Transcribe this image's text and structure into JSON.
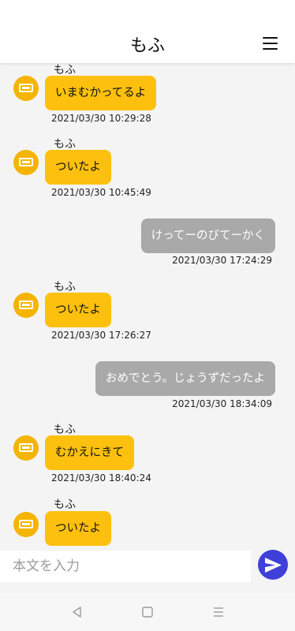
{
  "header": {
    "title": "もふ"
  },
  "messages": [
    {
      "direction": "in",
      "sender": "もふ",
      "text": "いまむかってるよ",
      "time": "2021/03/30 10:29:28"
    },
    {
      "direction": "in",
      "sender": "もふ",
      "text": "ついたよ",
      "time": "2021/03/30 10:45:49"
    },
    {
      "direction": "out",
      "text": "けってーのびてーかく",
      "time": "2021/03/30 17:24:29"
    },
    {
      "direction": "in",
      "sender": "もふ",
      "text": "ついたよ",
      "time": "2021/03/30 17:26:27"
    },
    {
      "direction": "out",
      "text": "おめでとう。じょうずだったよ",
      "time": "2021/03/30 18:34:09"
    },
    {
      "direction": "in",
      "sender": "もふ",
      "text": "むかえにきて",
      "time": "2021/03/30 18:40:24"
    },
    {
      "direction": "in",
      "sender": "もふ",
      "text": "ついたよ",
      "time": ""
    }
  ],
  "input": {
    "placeholder": "本文を入力",
    "value": ""
  },
  "icons": {
    "menu": "hamburger-menu-icon",
    "avatar": "battery-icon",
    "send": "paper-plane-icon",
    "nav_back": "triangle-back-icon",
    "nav_home": "square-home-icon",
    "nav_recent": "lines-recent-icon"
  },
  "colors": {
    "incoming_bubble": "#fdc00e",
    "outgoing_bubble": "#a9a9a9",
    "avatar": "#f4b400",
    "send_button": "#3f3fd9"
  }
}
